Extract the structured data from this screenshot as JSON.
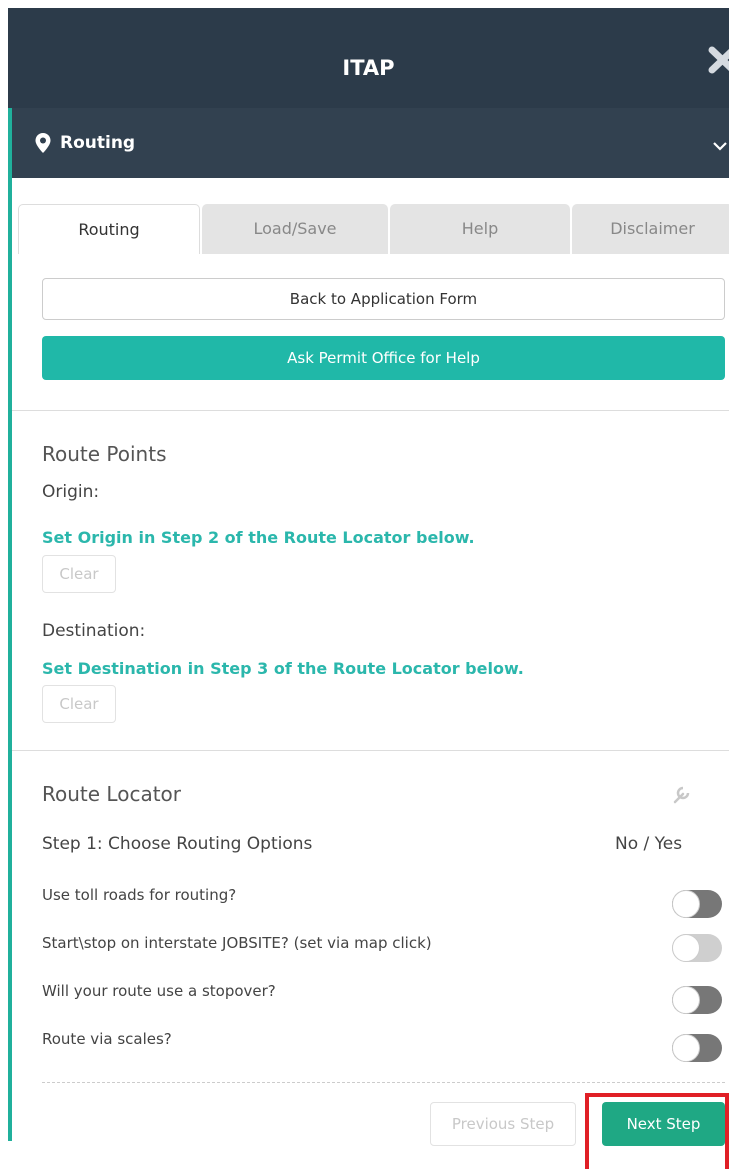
{
  "header": {
    "title": "ITAP"
  },
  "section": {
    "label": "Routing"
  },
  "tabs": [
    {
      "label": "Routing",
      "active": true
    },
    {
      "label": "Load/Save",
      "active": false
    },
    {
      "label": "Help",
      "active": false
    },
    {
      "label": "Disclaimer",
      "active": false
    }
  ],
  "buttons": {
    "back": "Back to Application Form",
    "ask": "Ask Permit Office for Help",
    "clear": "Clear",
    "previous": "Previous Step",
    "next": "Next Step"
  },
  "route_points": {
    "heading": "Route Points",
    "origin_label": "Origin:",
    "origin_hint": "Set Origin in Step 2 of the Route Locator below.",
    "destination_label": "Destination:",
    "destination_hint": "Set Destination in Step 3 of the Route Locator below."
  },
  "route_locator": {
    "heading": "Route Locator",
    "step1": "Step 1: Choose Routing Options",
    "no_yes": "No / Yes",
    "options": [
      {
        "label": "Use toll roads for routing?",
        "on": false,
        "enabled": true
      },
      {
        "label": "Start\\stop on interstate JOBSITE? (set via map click)",
        "on": false,
        "enabled": false
      },
      {
        "label": "Will your route use a stopover?",
        "on": false,
        "enabled": true
      },
      {
        "label": "Route via scales?",
        "on": false,
        "enabled": true
      }
    ]
  },
  "colors": {
    "header_bg": "#2c3b4a",
    "accent_teal": "#20b8a8",
    "next_green": "#1fa884",
    "highlight_red": "#e01f26"
  }
}
